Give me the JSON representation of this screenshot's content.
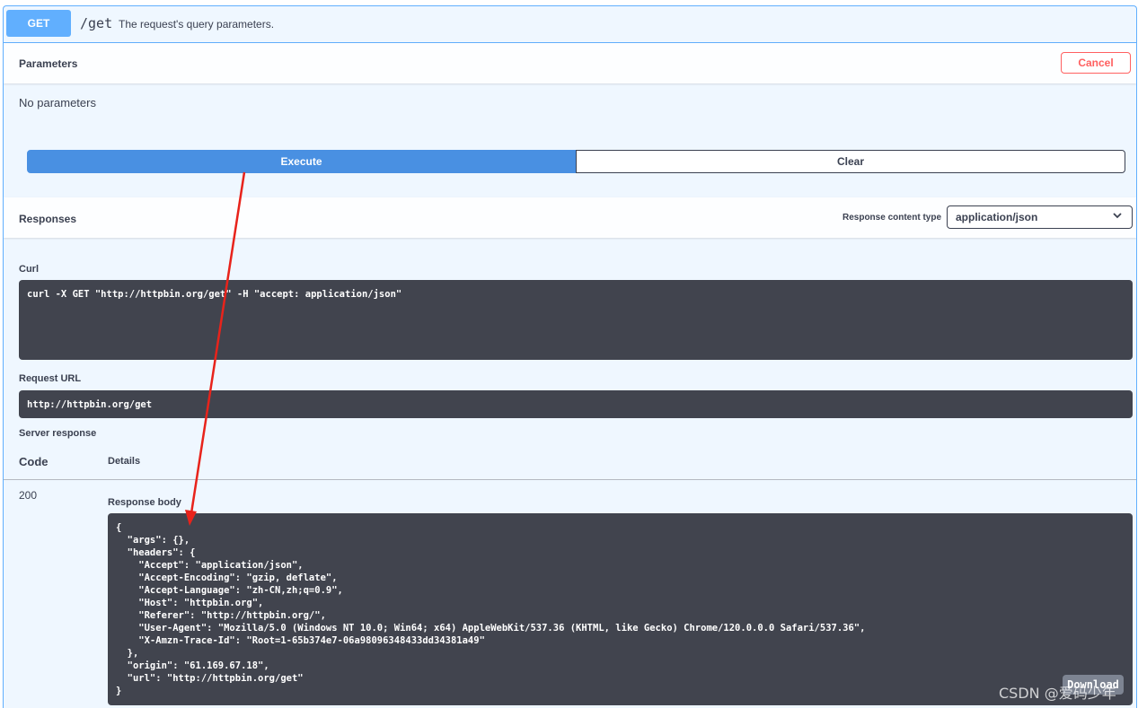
{
  "operation": {
    "method": "GET",
    "path": "/get",
    "description": "The request's query parameters."
  },
  "parameters": {
    "title": "Parameters",
    "cancel_label": "Cancel",
    "empty_text": "No parameters"
  },
  "actions": {
    "execute_label": "Execute",
    "clear_label": "Clear"
  },
  "responses": {
    "title": "Responses",
    "content_type_label": "Response content type",
    "content_type_value": "application/json"
  },
  "curl": {
    "label": "Curl",
    "command": "curl -X GET \"http://httpbin.org/get\" -H \"accept: application/json\""
  },
  "request_url": {
    "label": "Request URL",
    "value": "http://httpbin.org/get"
  },
  "server_response": {
    "label": "Server response",
    "code_header": "Code",
    "details_header": "Details",
    "code": "200",
    "body_label": "Response body",
    "body": "{\n  \"args\": {},\n  \"headers\": {\n    \"Accept\": \"application/json\",\n    \"Accept-Encoding\": \"gzip, deflate\",\n    \"Accept-Language\": \"zh-CN,zh;q=0.9\",\n    \"Host\": \"httpbin.org\",\n    \"Referer\": \"http://httpbin.org/\",\n    \"User-Agent\": \"Mozilla/5.0 (Windows NT 10.0; Win64; x64) AppleWebKit/537.36 (KHTML, like Gecko) Chrome/120.0.0.0 Safari/537.36\",\n    \"X-Amzn-Trace-Id\": \"Root=1-65b374e7-06a98096348433dd34381a49\"\n  },\n  \"origin\": \"61.169.67.18\",\n  \"url\": \"http://httpbin.org/get\"\n}",
    "download_label": "Download"
  },
  "watermark": "CSDN @爱码少年",
  "colors": {
    "get_accent": "#61affe",
    "execute": "#4990e2",
    "cancel": "#ff6060",
    "code_bg": "#41444e",
    "annotation_arrow": "#e8231b"
  },
  "icons": {
    "select_chevron": "chevron-down-icon"
  }
}
